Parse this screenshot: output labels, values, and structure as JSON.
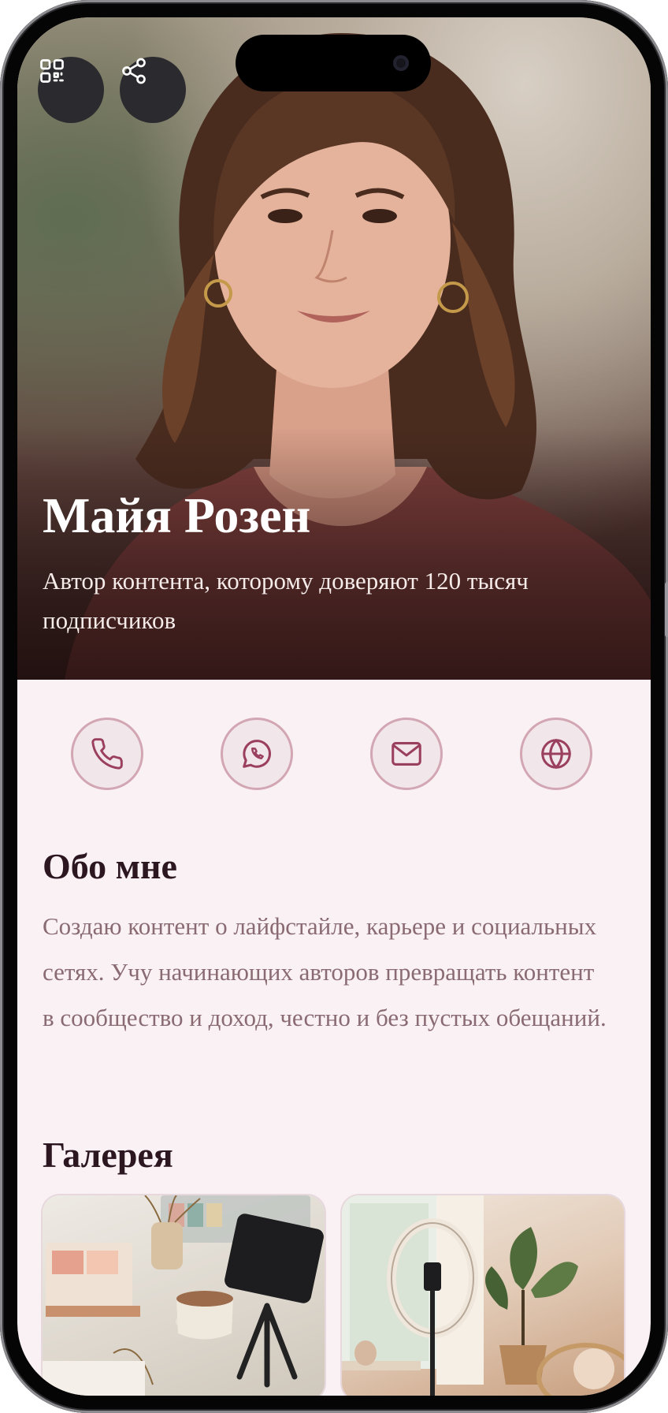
{
  "profile": {
    "name": "Майя Розен",
    "subtitle": "Автор контента, которому доверяют 120 тысяч подписчиков"
  },
  "header_actions": [
    {
      "icon": "qr-code-icon"
    },
    {
      "icon": "share-icon"
    }
  ],
  "contacts": [
    {
      "icon": "phone-icon"
    },
    {
      "icon": "whatsapp-icon"
    },
    {
      "icon": "mail-icon"
    },
    {
      "icon": "globe-icon"
    }
  ],
  "about": {
    "title": "Обо мне",
    "text": "Создаю контент о лайфстайле, карьере и социальных сетях. Учу начинающих авторов превращать контент в сообщество и доход, честно и без пустых обещаний."
  },
  "gallery": {
    "title": "Галерея",
    "items": [
      {
        "subject": "workspace-desk-photo"
      },
      {
        "subject": "ring-light-studio-photo"
      }
    ]
  },
  "colors": {
    "accent": "#9b3f5e",
    "page_bg": "#f9f1f4",
    "contact_ring": "#d3a6b4",
    "heading": "#2c1720",
    "body_text": "#8a6a73"
  }
}
